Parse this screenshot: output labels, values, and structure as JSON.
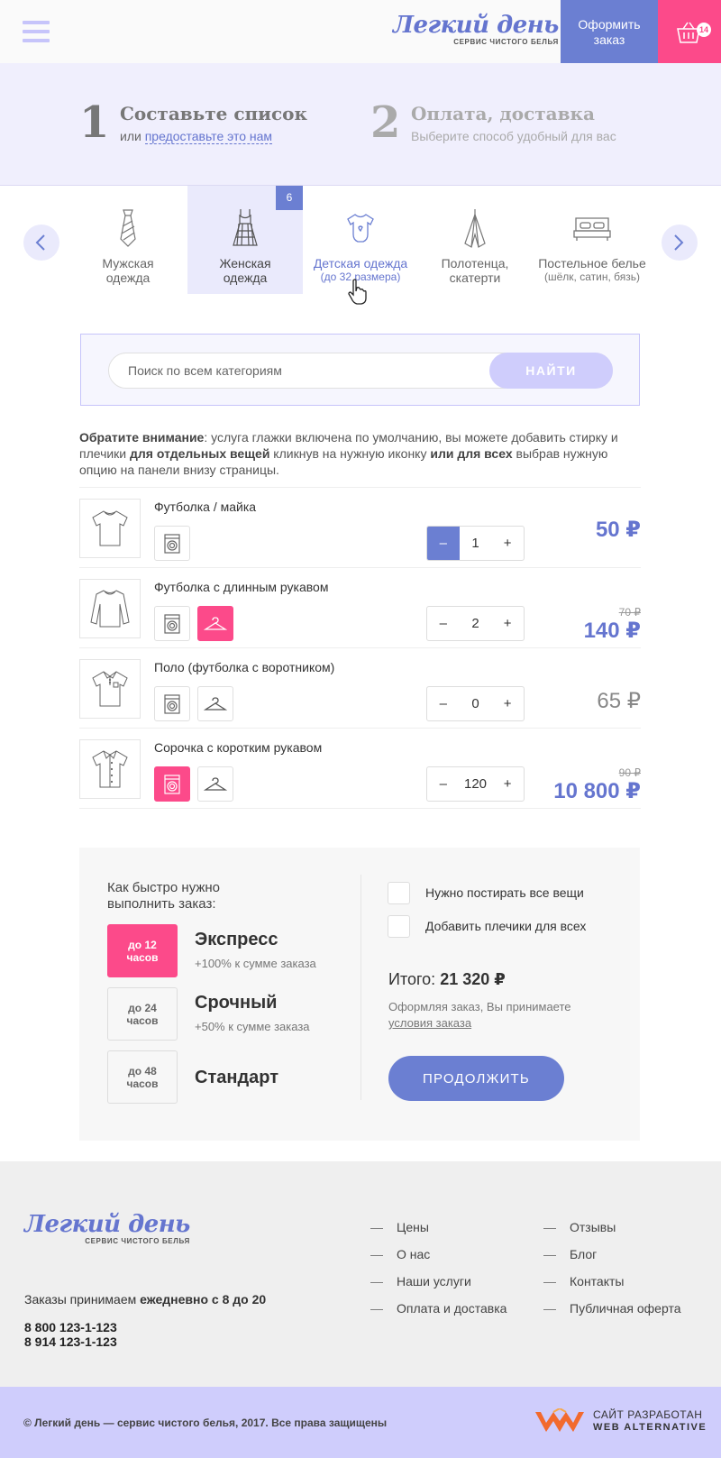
{
  "header": {
    "logo_name": "Легкий день",
    "logo_sub": "СЕРВИС ЧИСТОГО БЕЛЬЯ",
    "order_label": "Оформить заказ",
    "cart_count": "14"
  },
  "steps": [
    {
      "num": "1",
      "title": "Составьте список",
      "sub_prefix": "или",
      "sub_link": "предоставьте это нам"
    },
    {
      "num": "2",
      "title": "Оплата, доставка",
      "sub": "Выберите способ удобный для вас"
    }
  ],
  "categories": [
    {
      "label": "Мужская одежда",
      "icon": "tie-icon"
    },
    {
      "label": "Женская одежда",
      "icon": "dress-icon",
      "badge": "6",
      "active": true
    },
    {
      "label": "Детская одежда",
      "sub": "(до 32 размера)",
      "icon": "baby-bodysuit-icon"
    },
    {
      "label": "Полотенца, скатерти",
      "icon": "towel-icon"
    },
    {
      "label": "Постельное белье",
      "sub": "(шёлк, сатин, бязь)",
      "icon": "bed-icon"
    }
  ],
  "search": {
    "placeholder": "Поиск по всем категориям",
    "button": "НАЙТИ"
  },
  "notice": {
    "b1": "Обратите внимание",
    "t1": ": услуга глажки включена по умолчанию, вы можете добавить стирку и плечики ",
    "b2": "для отдельных вещей",
    "t2": " кликнув на нужную иконку ",
    "b3": "или для всех",
    "t3": " выбрав нужную опцию на панели внизу страницы."
  },
  "items": [
    {
      "name": "Футболка / майка",
      "qty": "1",
      "price": "50 ₽",
      "old_price": "",
      "wash_on": false,
      "hanger": null
    },
    {
      "name": "Футболка с длинным рукавом",
      "qty": "2",
      "price": "140 ₽",
      "old_price": "70 ₽",
      "wash_on": false,
      "hanger": true
    },
    {
      "name": "Поло (футболка с воротником)",
      "qty": "0",
      "price": "65 ₽",
      "old_price": "",
      "wash_on": false,
      "hanger": false
    },
    {
      "name": "Сорочка с коротким рукавом",
      "qty": "120",
      "price": "10 800 ₽",
      "old_price": "90 ₽",
      "wash_on": true,
      "hanger": false
    }
  ],
  "order": {
    "speed_question": "Как быстро нужно выполнить заказ:",
    "speeds": [
      {
        "box_line1": "до 12",
        "box_line2": "часов",
        "name": "Экспресс",
        "note": "+100% к сумме заказа",
        "selected": true
      },
      {
        "box_line1": "до 24",
        "box_line2": "часов",
        "name": "Срочный",
        "note": "+50% к сумме заказа",
        "selected": false
      },
      {
        "box_line1": "до 48",
        "box_line2": "часов",
        "name": "Стандарт",
        "note": "",
        "selected": false
      }
    ],
    "wash_all": "Нужно постирать все вещи",
    "hangers_all": "Добавить плечики для всех",
    "total_label": "Итого:",
    "total_value": "21 320 ₽",
    "terms_text": "Оформляя заказ, Вы принимаете",
    "terms_link": "условия заказа",
    "continue": "ПРОДОЛЖИТЬ"
  },
  "footer": {
    "logo_name": "Легкий день",
    "logo_sub": "СЕРВИС ЧИСТОГО БЕЛЬЯ",
    "hours_prefix": "Заказы  принимаем",
    "hours_bold": "ежедневно с 8 до 20",
    "phones": [
      "8 800 123-1-123",
      "8 914  123-1-123"
    ],
    "links_col1": [
      "Цены",
      "О нас",
      "Наши услуги",
      "Оплата и доставка"
    ],
    "links_col2": [
      "Отзывы",
      "Блог",
      "Контакты",
      "Публичная оферта"
    ],
    "copyright": "© Легкий день — сервис чистого белья, 2017. Все права защищены",
    "dev_line1": "САЙТ РАЗРАБОТАН",
    "dev_line2": "WEB ALTERNATIVE"
  },
  "colors": {
    "accent": "#6b7fd2",
    "pink": "#fc4a8a",
    "lavender": "#cfcdfc"
  }
}
